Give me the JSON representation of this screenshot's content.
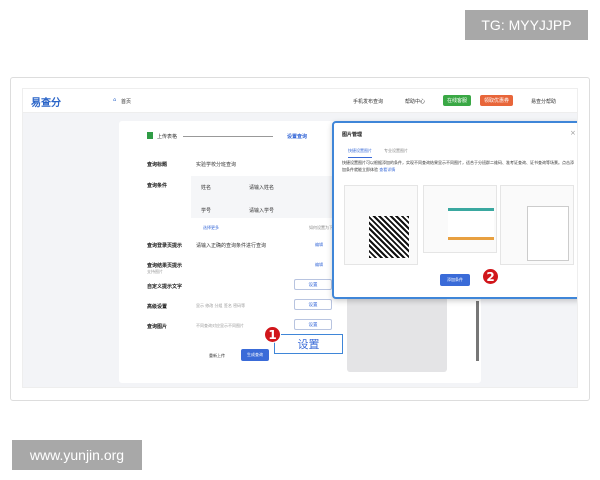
{
  "watermarks": {
    "top": "TG: MYYJJPP",
    "bottom": "www.yunjin.org"
  },
  "header": {
    "logo": "易查分",
    "home": "首页",
    "mobile": "手机发布查询",
    "help": "帮助中心",
    "online": "在线客服",
    "promo": "领取优惠券",
    "user": "易查分帮助"
  },
  "steps": {
    "step1": "上传表格",
    "step2": "设置查询"
  },
  "form": {
    "title_label": "查询标题",
    "title_value": "实验学校分班查询",
    "cond_label": "查询条件",
    "conditions": [
      {
        "name": "姓名",
        "placeholder": "请输入姓名"
      },
      {
        "name": "学号",
        "placeholder": "请输入学号"
      }
    ],
    "more": "选择更多",
    "dropdown_help": "如何设置为下拉",
    "login_tip_label": "查询登录页提示",
    "login_tip_value": "请输入正确的查询条件进行查询",
    "result_tip_label": "查询结果页提示",
    "result_tip_sub": "支持图片",
    "edit": "编辑",
    "custom_label": "自定义提示文字",
    "advanced_label": "高级设置",
    "advanced_desc": "显示 修改 分组 签名 密码等",
    "image_label": "查询图片",
    "image_desc": "不同查询对应显示不同图片",
    "set": "设置",
    "reupload": "重新上传",
    "generate": "生成查询"
  },
  "callout": {
    "number": "1",
    "label": "设置"
  },
  "modal": {
    "title": "图片管理",
    "close": "×",
    "tabs": [
      "快捷设置图片",
      "专业设置图片"
    ],
    "desc": "快捷设置图片可以根据添加的条件，实现不同查询结果显示不同图片，适合于分班群二维码、准考证查询、证书查询等场景。点击添加条件就能立即体验",
    "link": "查看详情",
    "add_button": "添加条件",
    "number": "2"
  },
  "colors": {
    "accent": "#3a6bd8",
    "badge": "#d1161b",
    "online": "#3aa845",
    "promo": "#e8663a"
  }
}
